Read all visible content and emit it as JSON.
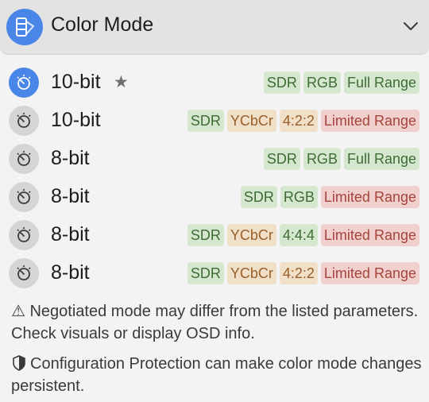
{
  "header": {
    "title": "Color Mode",
    "icon": "display-color-icon",
    "chevron": "chevron-down-icon"
  },
  "modes": [
    {
      "label": "10-bit",
      "favorite": true,
      "active": true,
      "tags": [
        {
          "text": "SDR",
          "color": "green"
        },
        {
          "text": "RGB",
          "color": "green"
        },
        {
          "text": "Full Range",
          "color": "green"
        }
      ]
    },
    {
      "label": "10-bit",
      "favorite": false,
      "active": false,
      "tags": [
        {
          "text": "SDR",
          "color": "green"
        },
        {
          "text": "YCbCr",
          "color": "orange"
        },
        {
          "text": "4:2:2",
          "color": "orange"
        },
        {
          "text": "Limited Range",
          "color": "red"
        }
      ]
    },
    {
      "label": "8-bit",
      "favorite": false,
      "active": false,
      "tags": [
        {
          "text": "SDR",
          "color": "green"
        },
        {
          "text": "RGB",
          "color": "green"
        },
        {
          "text": "Full Range",
          "color": "green"
        }
      ]
    },
    {
      "label": "8-bit",
      "favorite": false,
      "active": false,
      "tags": [
        {
          "text": "SDR",
          "color": "green"
        },
        {
          "text": "RGB",
          "color": "green"
        },
        {
          "text": "Limited Range",
          "color": "red"
        }
      ]
    },
    {
      "label": "8-bit",
      "favorite": false,
      "active": false,
      "tags": [
        {
          "text": "SDR",
          "color": "green"
        },
        {
          "text": "YCbCr",
          "color": "orange"
        },
        {
          "text": "4:4:4",
          "color": "green"
        },
        {
          "text": "Limited Range",
          "color": "red"
        }
      ]
    },
    {
      "label": "8-bit",
      "favorite": false,
      "active": false,
      "tags": [
        {
          "text": "SDR",
          "color": "green"
        },
        {
          "text": "YCbCr",
          "color": "orange"
        },
        {
          "text": "4:2:2",
          "color": "orange"
        },
        {
          "text": "Limited Range",
          "color": "red"
        }
      ]
    }
  ],
  "notes": {
    "warning": "⚠ Negotiated mode may differ from the listed parameters. Check visuals or display OSD info.",
    "protection": "Configuration Protection can make color mode changes persistent."
  },
  "colors": {
    "accent": "#4a86e8",
    "tag_green_bg": "#d6e7cf",
    "tag_orange_bg": "#f2dfc7",
    "tag_red_bg": "#f0cfcd"
  }
}
